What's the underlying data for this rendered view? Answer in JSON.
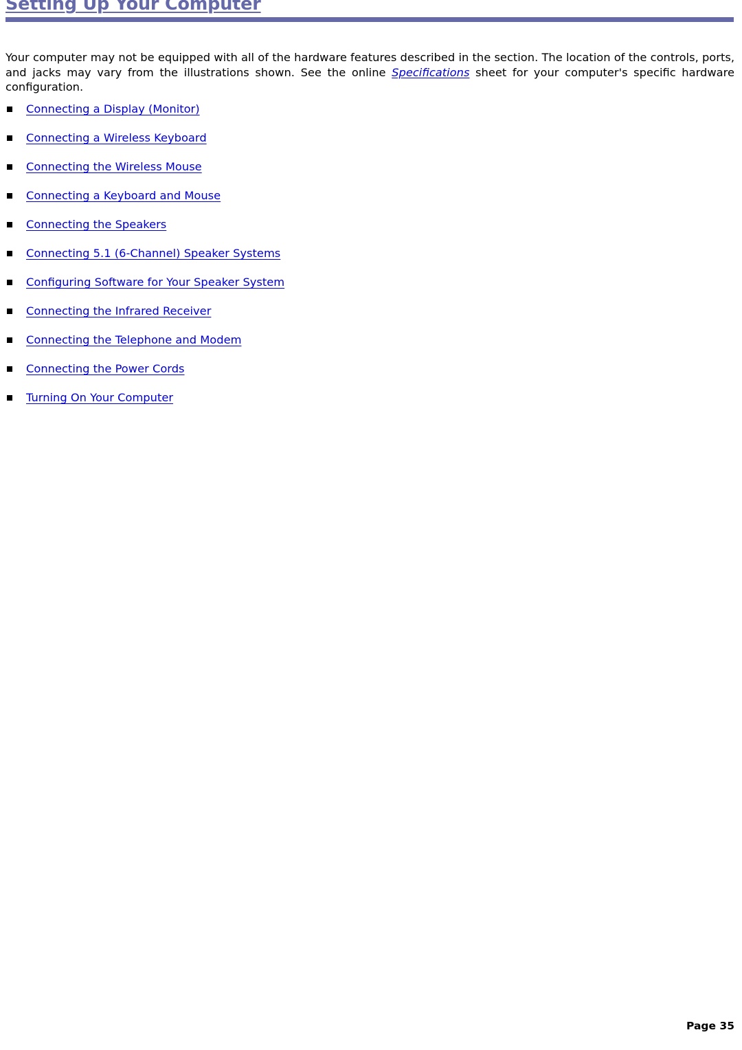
{
  "document": {
    "heading": "Setting Up Your Computer",
    "heading_color": "#6569a8",
    "link_color": "#0000d0",
    "intro": {
      "part1": "Your computer may not be equipped with all of the hardware features described in the section. The location of the controls, ports, and jacks may vary from the illustrations shown. See the online ",
      "link": "Specifications",
      "part2": " sheet for your computer's specific hardware configuration."
    },
    "topics": [
      {
        "label": "Connecting a Display (Monitor)"
      },
      {
        "label": "Connecting a Wireless Keyboard"
      },
      {
        "label": "Connecting the Wireless Mouse"
      },
      {
        "label": "Connecting a Keyboard and Mouse"
      },
      {
        "label": "Connecting the Speakers"
      },
      {
        "label": "Connecting 5.1 (6-Channel) Speaker Systems"
      },
      {
        "label": "Configuring Software for Your Speaker System"
      },
      {
        "label": "Connecting the Infrared Receiver"
      },
      {
        "label": "Connecting the Telephone and Modem"
      },
      {
        "label": "Connecting the Power Cords"
      },
      {
        "label": "Turning On Your Computer"
      }
    ],
    "footer": {
      "page_label": "Page 35"
    }
  }
}
